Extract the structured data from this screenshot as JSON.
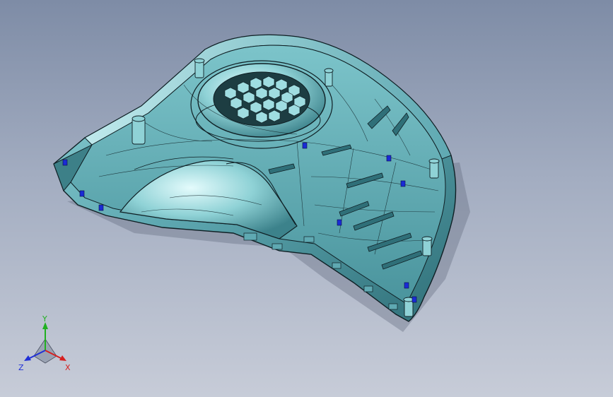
{
  "viewport": {
    "background_top": "#7e8ca6",
    "background_bottom": "#c7ccd8",
    "model_color": "#6fb8bf",
    "model_highlight": "#cfeff2",
    "model_shadow": "#2f6f78",
    "edge_color": "#0f1f24",
    "marker_color": "#1a2bd6"
  },
  "model": {
    "icon": "cad-part-housing",
    "feature_icon": "honeycomb-grille-icon"
  },
  "triad": {
    "x_label": "X",
    "y_label": "Y",
    "z_label": "Z",
    "x_color": "#d62020",
    "y_color": "#20b020",
    "z_color": "#2030d6"
  }
}
